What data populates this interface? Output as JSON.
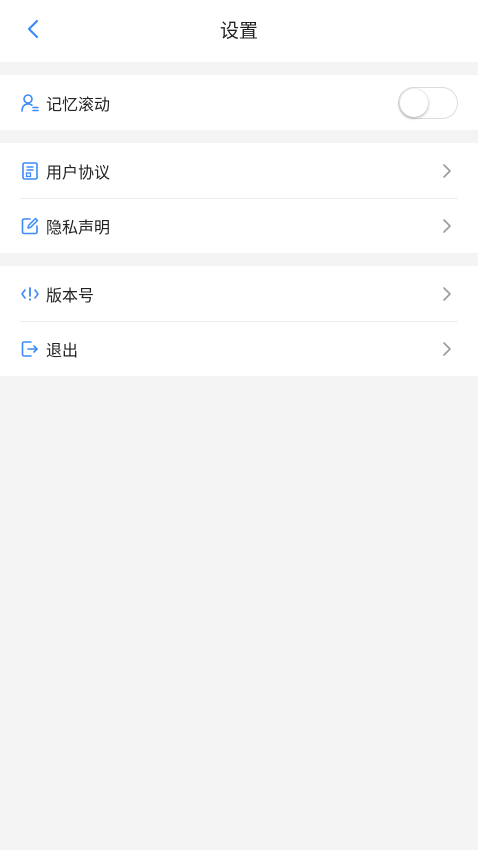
{
  "header": {
    "title": "设置"
  },
  "colors": {
    "accent": "#3d8af7",
    "background": "#f4f4f4",
    "card": "#ffffff",
    "divider": "#ededed",
    "chevron": "#9a9a9a"
  },
  "sections": [
    {
      "items": [
        {
          "label": "记忆滚动",
          "icon": "user-icon",
          "control": "toggle",
          "toggle_on": false
        }
      ]
    },
    {
      "items": [
        {
          "label": "用户协议",
          "icon": "document-icon",
          "control": "chevron"
        },
        {
          "label": "隐私声明",
          "icon": "edit-icon",
          "control": "chevron"
        }
      ]
    },
    {
      "items": [
        {
          "label": "版本号",
          "icon": "code-info-icon",
          "control": "chevron"
        },
        {
          "label": "退出",
          "icon": "logout-icon",
          "control": "chevron"
        }
      ]
    }
  ]
}
